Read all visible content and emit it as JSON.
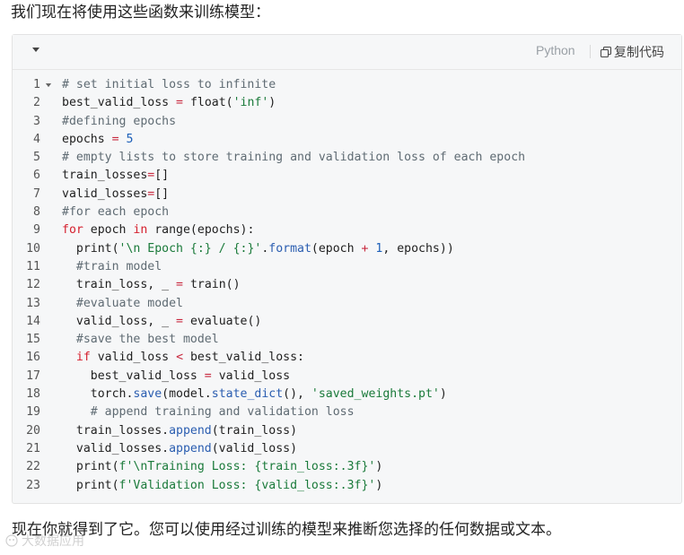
{
  "intro_text": "我们现在将使用这些函数来训练模型：",
  "code_block": {
    "language": "Python",
    "copy_label": "复制代码",
    "lines": [
      {
        "n": "1",
        "tokens": [
          {
            "t": "# set initial loss to infinite",
            "c": "comment"
          }
        ]
      },
      {
        "n": "2",
        "tokens": [
          {
            "t": "best_valid_loss "
          },
          {
            "t": "=",
            "c": "op"
          },
          {
            "t": " float("
          },
          {
            "t": "'inf'",
            "c": "string"
          },
          {
            "t": ")"
          }
        ]
      },
      {
        "n": "3",
        "tokens": [
          {
            "t": "#defining epochs",
            "c": "comment"
          }
        ]
      },
      {
        "n": "4",
        "tokens": [
          {
            "t": "epochs "
          },
          {
            "t": "=",
            "c": "op"
          },
          {
            "t": " "
          },
          {
            "t": "5",
            "c": "number"
          }
        ]
      },
      {
        "n": "5",
        "tokens": [
          {
            "t": "# empty lists to store training and validation loss of each epoch",
            "c": "comment"
          }
        ]
      },
      {
        "n": "6",
        "tokens": [
          {
            "t": "train_losses"
          },
          {
            "t": "=",
            "c": "op"
          },
          {
            "t": "[]"
          }
        ]
      },
      {
        "n": "7",
        "tokens": [
          {
            "t": "valid_losses"
          },
          {
            "t": "=",
            "c": "op"
          },
          {
            "t": "[]"
          }
        ]
      },
      {
        "n": "8",
        "tokens": [
          {
            "t": "#for each epoch",
            "c": "comment"
          }
        ]
      },
      {
        "n": "9",
        "fold": true,
        "tokens": [
          {
            "t": "for",
            "c": "keyword"
          },
          {
            "t": " epoch "
          },
          {
            "t": "in",
            "c": "keyword"
          },
          {
            "t": " range(epochs):"
          }
        ]
      },
      {
        "n": "10",
        "tokens": [
          {
            "t": "  print("
          },
          {
            "t": "'\\n Epoch {:} / {:}'",
            "c": "string"
          },
          {
            "t": "."
          },
          {
            "t": "format",
            "c": "method"
          },
          {
            "t": "(epoch "
          },
          {
            "t": "+",
            "c": "op"
          },
          {
            "t": " "
          },
          {
            "t": "1",
            "c": "number"
          },
          {
            "t": ", epochs))"
          }
        ]
      },
      {
        "n": "11",
        "tokens": [
          {
            "t": "  "
          },
          {
            "t": "#train model",
            "c": "comment"
          }
        ]
      },
      {
        "n": "12",
        "tokens": [
          {
            "t": "  train_loss, _ "
          },
          {
            "t": "=",
            "c": "op"
          },
          {
            "t": " train()"
          }
        ]
      },
      {
        "n": "13",
        "tokens": [
          {
            "t": "  "
          },
          {
            "t": "#evaluate model",
            "c": "comment"
          }
        ]
      },
      {
        "n": "14",
        "tokens": [
          {
            "t": "  valid_loss, _ "
          },
          {
            "t": "=",
            "c": "op"
          },
          {
            "t": " evaluate()"
          }
        ]
      },
      {
        "n": "15",
        "tokens": [
          {
            "t": "  "
          },
          {
            "t": "#save the best model",
            "c": "comment"
          }
        ]
      },
      {
        "n": "16",
        "fold": true,
        "tokens": [
          {
            "t": "  "
          },
          {
            "t": "if",
            "c": "keyword"
          },
          {
            "t": " valid_loss "
          },
          {
            "t": "<",
            "c": "op"
          },
          {
            "t": " best_valid_loss:"
          }
        ]
      },
      {
        "n": "17",
        "tokens": [
          {
            "t": "    best_valid_loss "
          },
          {
            "t": "=",
            "c": "op"
          },
          {
            "t": " valid_loss"
          }
        ]
      },
      {
        "n": "18",
        "tokens": [
          {
            "t": "    torch."
          },
          {
            "t": "save",
            "c": "method"
          },
          {
            "t": "(model."
          },
          {
            "t": "state_dict",
            "c": "method"
          },
          {
            "t": "(), "
          },
          {
            "t": "'saved_weights.pt'",
            "c": "string"
          },
          {
            "t": ")"
          }
        ]
      },
      {
        "n": "19",
        "tokens": [
          {
            "t": "    "
          },
          {
            "t": "# append training and validation loss",
            "c": "comment"
          }
        ]
      },
      {
        "n": "20",
        "tokens": [
          {
            "t": "  train_losses."
          },
          {
            "t": "append",
            "c": "method"
          },
          {
            "t": "(train_loss)"
          }
        ]
      },
      {
        "n": "21",
        "tokens": [
          {
            "t": "  valid_losses."
          },
          {
            "t": "append",
            "c": "method"
          },
          {
            "t": "(valid_loss)"
          }
        ]
      },
      {
        "n": "22",
        "tokens": [
          {
            "t": "  print("
          },
          {
            "t": "f'\\nTraining Loss: {train_loss:.3f}'",
            "c": "string"
          },
          {
            "t": ")"
          }
        ]
      },
      {
        "n": "23",
        "tokens": [
          {
            "t": "  print("
          },
          {
            "t": "f'Validation Loss: {valid_loss:.3f}'",
            "c": "string"
          },
          {
            "t": ")"
          }
        ]
      }
    ]
  },
  "outro_text": "现在你就得到了它。您可以使用经过训练的模型来推断您选择的任何数据或文本。",
  "watermark_text": "大数据应用",
  "icons": {
    "collapse": "chevron-down-icon",
    "copy": "copy-icon",
    "fold": "fold-caret-icon",
    "watermark": "wechat-logo-icon"
  }
}
